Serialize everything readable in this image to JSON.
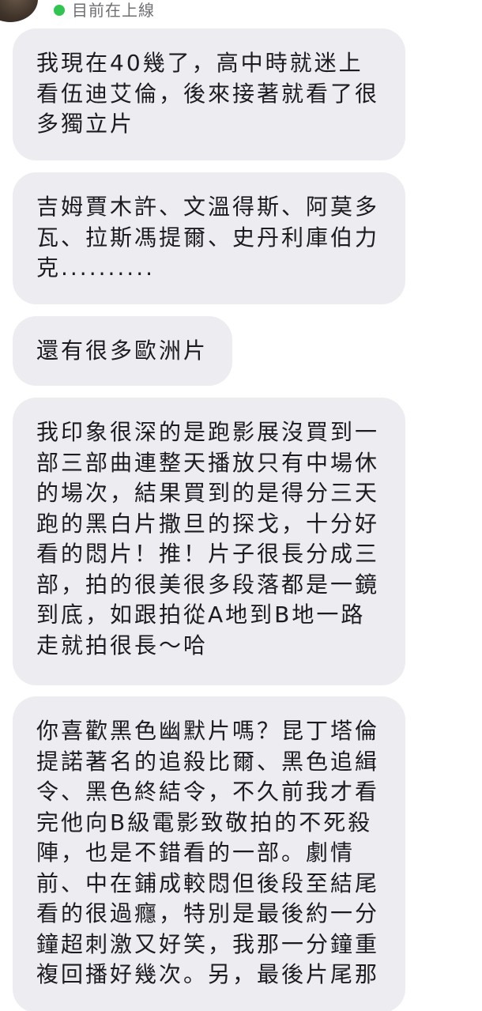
{
  "header": {
    "status_text": "目前在上線",
    "status_color": "#31c450"
  },
  "messages": [
    {
      "lines": [
        "我現在40幾了，高中時就迷上",
        "看伍迪艾倫，後來接著就看了很",
        "多獨立片"
      ]
    },
    {
      "lines": [
        "吉姆賈木許、文溫得斯、阿莫多",
        "瓦、拉斯馮提爾、史丹利庫伯力",
        "克.........."
      ]
    },
    {
      "lines": [
        "還有很多歐洲片"
      ]
    },
    {
      "lines": [
        "我印象很深的是跑影展沒買到一",
        "部三部曲連整天播放只有中場休",
        "的場次，結果買到的是得分三天",
        "跑的黑白片撒旦的探戈，十分好",
        "看的悶片！推！片子很長分成三",
        "部，拍的很美很多段落都是一鏡",
        "到底，如跟拍從A地到B地一路",
        "走就拍很長～哈"
      ]
    },
    {
      "lines": [
        "你喜歡黑色幽默片嗎？昆丁塔倫",
        "提諾著名的追殺比爾、黑色追緝",
        "令、黑色終結令，不久前我才看",
        "完他向B級電影致敬拍的不死殺",
        "陣，也是不錯看的一部。劇情",
        "前、中在鋪成較悶但後段至結尾",
        "看的很過癮，特別是最後約一分",
        "鐘超刺激又好笑，我那一分鐘重",
        "複回播好幾次。另，最後片尾那"
      ]
    }
  ]
}
